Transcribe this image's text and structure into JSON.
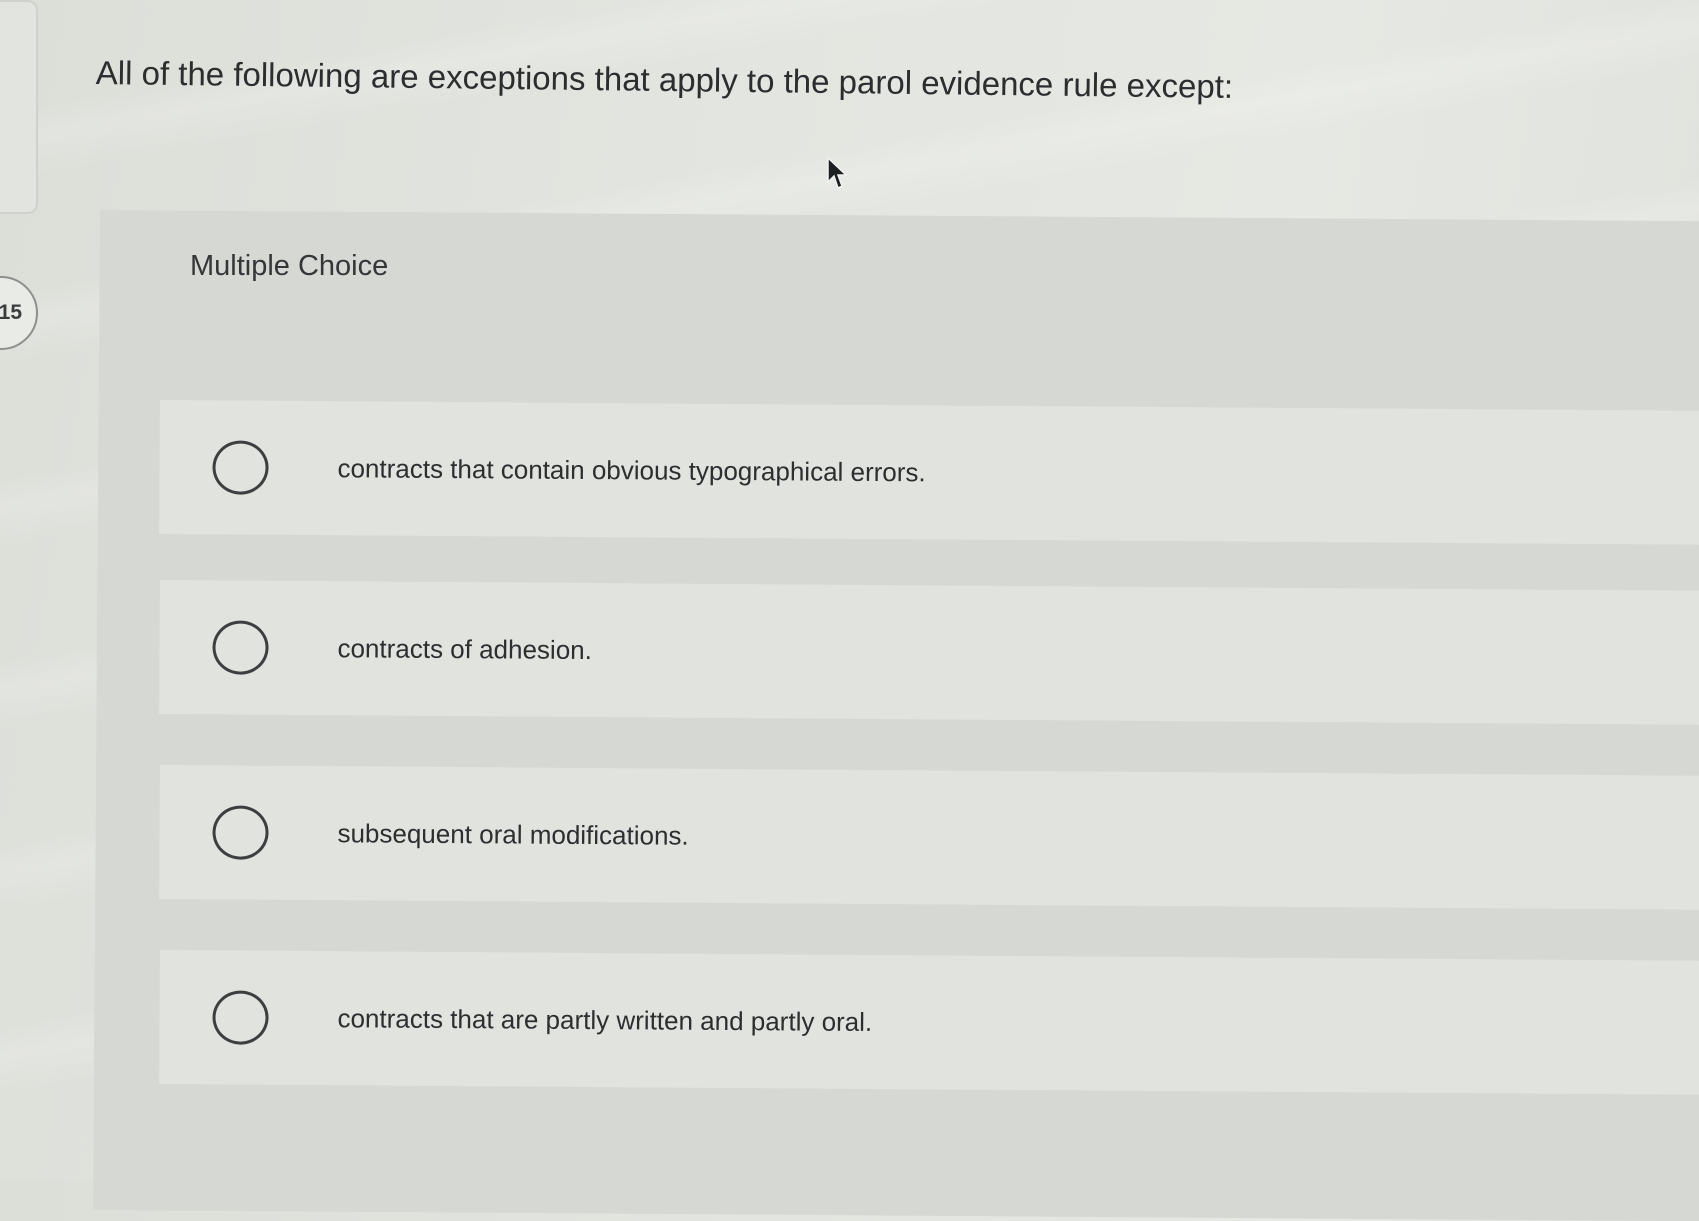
{
  "question": {
    "number": "15",
    "text": "All of the following are exceptions that apply to the parol evidence rule except:"
  },
  "question_type": "Multiple Choice",
  "options": [
    {
      "label": "contracts that contain obvious typographical errors."
    },
    {
      "label": "contracts of adhesion."
    },
    {
      "label": "subsequent oral modifications."
    },
    {
      "label": "contracts that are partly written and partly oral."
    }
  ],
  "colors": {
    "background": "#e3e5e0",
    "panel": "#d6d8d3",
    "option_row": "#e1e3de",
    "text": "#2b2d2e"
  }
}
